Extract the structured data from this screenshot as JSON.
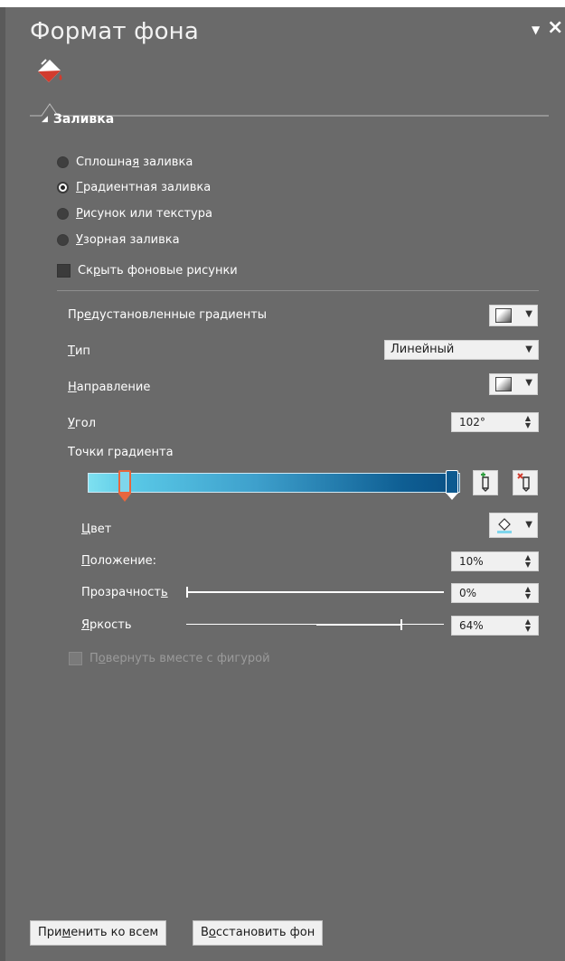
{
  "panel": {
    "title": "Формат фона",
    "pin_icon": "chevron-down-icon",
    "close_icon": "close-icon",
    "tab_icon": "paint-bucket-icon"
  },
  "fill_section": {
    "header": "Заливка",
    "options": [
      {
        "pre": "Сплошна",
        "u": "я",
        "post": " заливка",
        "checked": false
      },
      {
        "pre": "",
        "u": "Г",
        "post": "радиентная заливка",
        "checked": true
      },
      {
        "pre": "",
        "u": "Р",
        "post": "исунок или текстура",
        "checked": false
      },
      {
        "pre": "",
        "u": "У",
        "post": "зорная заливка",
        "checked": false
      }
    ],
    "hide_bg": {
      "pre": "Ск",
      "u": "р",
      "post": "ыть фоновые рисунки"
    }
  },
  "gradient": {
    "preset_label": {
      "pre": "Пр",
      "u": "е",
      "post": "дустановленные градиенты"
    },
    "type_label": {
      "pre": "",
      "u": "Т",
      "post": "ип"
    },
    "type_value": "Линейный",
    "direction_label": {
      "pre": "",
      "u": "Н",
      "post": "аправление"
    },
    "angle_label": {
      "pre": "",
      "u": "У",
      "post": "гол"
    },
    "angle_value": "102°",
    "stops_label": "Точки градиента",
    "stops": [
      {
        "position": 10,
        "color": "#7fd6ec",
        "selected": true
      },
      {
        "position": 100,
        "color": "#0d5a90",
        "selected": false
      }
    ],
    "color_label": {
      "pre": "",
      "u": "Ц",
      "post": "вет"
    },
    "position_label": {
      "pre": "",
      "u": "П",
      "post": "оложение:"
    },
    "position_value": "10%",
    "transparency_label": {
      "pre": "Прозрачност",
      "u": "ь",
      "post": ""
    },
    "transparency_value": "0%",
    "transparency_level": 0,
    "brightness_label": {
      "pre": "",
      "u": "Я",
      "post": "ркость"
    },
    "brightness_value": "64%",
    "brightness_level": 64,
    "rotate_label": {
      "pre": "П",
      "u": "о",
      "post": "вернуть вместе с фигурой"
    }
  },
  "buttons": {
    "apply_all": {
      "pre": "При",
      "u": "м",
      "post": "енить ко всем"
    },
    "reset_bg": {
      "pre": "В",
      "u": "о",
      "post": "сстановить фон"
    }
  },
  "colors": {
    "panel_bg": "#6a6a6a",
    "accent_stop": "#e8663d"
  }
}
